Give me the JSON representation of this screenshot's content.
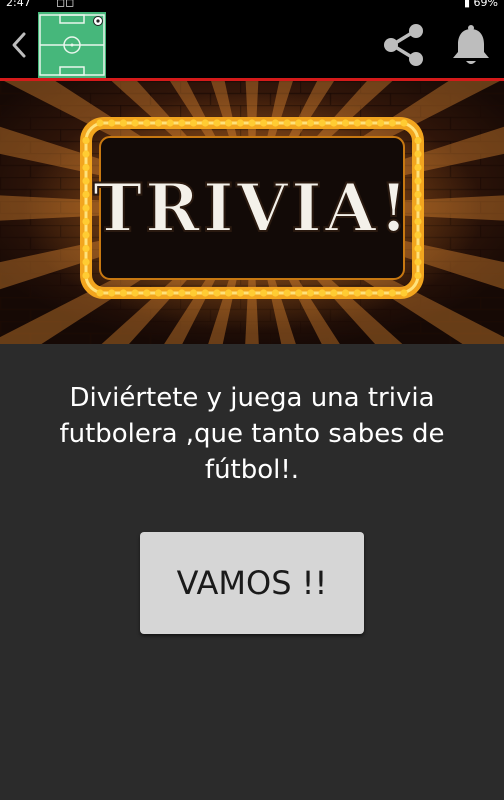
{
  "status_bar": {
    "time": "2:47",
    "signal": "◻◻",
    "battery": "▮ 69%"
  },
  "app_bar": {
    "back_icon": "chevron-left-icon",
    "logo": "soccer-field-icon",
    "share_icon": "share-icon",
    "notification_icon": "bell-icon"
  },
  "banner": {
    "title": "TRIVIA!"
  },
  "main": {
    "message": "Diviértete y juega una trivia futbolera ,que tanto sabes de fútbol!.",
    "button_label": "VAMOS !!"
  },
  "colors": {
    "background": "#2b2b2b",
    "app_bar": "#000000",
    "divider": "#d51a1a",
    "button": "#d6d6d6",
    "bulb": "#ffcc33"
  }
}
